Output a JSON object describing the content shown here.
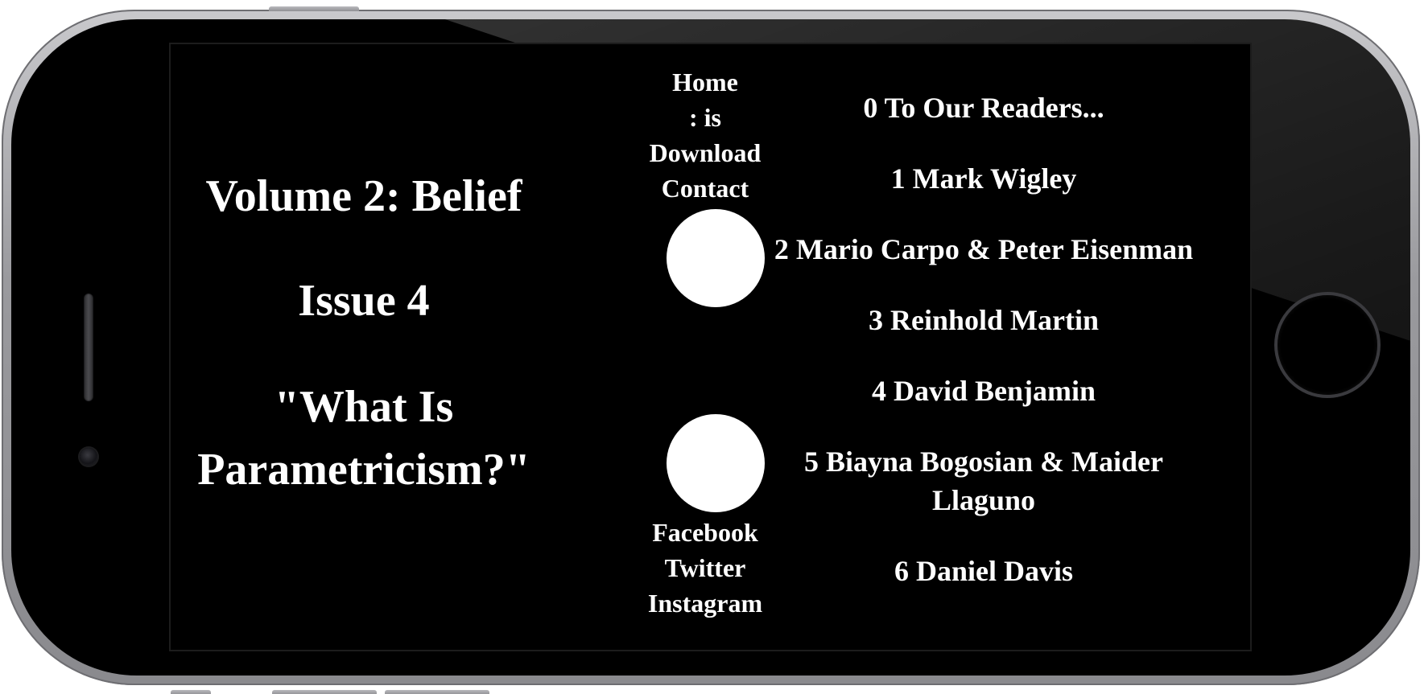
{
  "issue": {
    "volume": "Volume 2: Belief",
    "issue": "Issue 4",
    "title_line1": "\"What Is",
    "title_line2": "Parametricism?\""
  },
  "nav": {
    "home": "Home",
    "is": ": is",
    "download": "Download",
    "contact": "Contact"
  },
  "social": {
    "facebook": "Facebook",
    "twitter": "Twitter",
    "instagram": "Instagram"
  },
  "articles": [
    {
      "label": "0 To Our Readers..."
    },
    {
      "label": "1 Mark Wigley"
    },
    {
      "label": "2 Mario Carpo & Peter Eisenman"
    },
    {
      "label": "3 Reinhold Martin"
    },
    {
      "label": "4 David Benjamin"
    },
    {
      "label": "5 Biayna Bogosian & Maider Llaguno"
    },
    {
      "label": "6 Daniel Davis"
    }
  ],
  "colors": {
    "background": "#000000",
    "text": "#ffffff",
    "phone_frame": "#9a9a9e"
  },
  "icons": {
    "top_circle": "circle-icon",
    "bottom_circle": "circle-icon"
  }
}
